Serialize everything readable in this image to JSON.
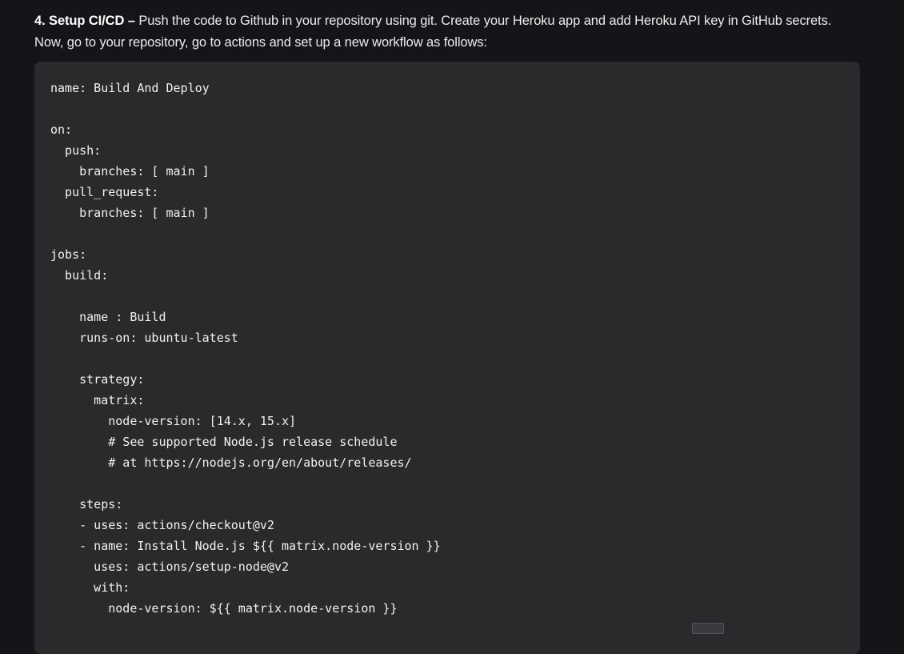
{
  "intro": {
    "step_title": "4. Setup CI/CD –",
    "text_line1": " Push the code to Github in your repository using git. Create your Heroku app and add Heroku API key in GitHub secrets.",
    "text_line2": "Now, go to your repository, go to actions and set up a new workflow as follows:"
  },
  "code": {
    "language": "yaml",
    "lines": [
      "name: Build And Deploy",
      "",
      "on:",
      "  push:",
      "    branches: [ main ]",
      "  pull_request:",
      "    branches: [ main ]",
      "",
      "jobs:",
      "  build:",
      "",
      "    name : Build",
      "    runs-on: ubuntu-latest",
      "",
      "    strategy:",
      "      matrix:",
      "        node-version: [14.x, 15.x]",
      "        # See supported Node.js release schedule",
      "        # at https://nodejs.org/en/about/releases/",
      "",
      "    steps:",
      "    - uses: actions/checkout@v2",
      "    - name: Install Node.js ${{ matrix.node-version }}",
      "      uses: actions/setup-node@v2",
      "      with:",
      "        node-version: ${{ matrix.node-version }}"
    ]
  },
  "colors": {
    "page_background": "#141518",
    "code_background": "#2a2a2d",
    "text": "#ececec"
  }
}
